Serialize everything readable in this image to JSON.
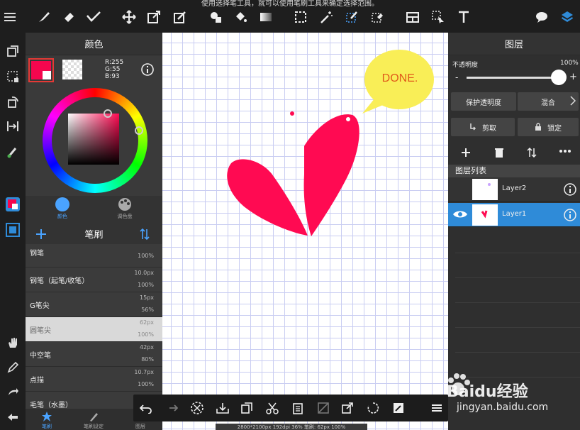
{
  "hint": "使用选择笔工具，就可以使用笔刷工具来确定选择范围。",
  "color_panel": {
    "title": "颜色",
    "primary_color": "#f5064e",
    "rgb": {
      "r": "R:255",
      "g": "G:55",
      "b": "B:93"
    },
    "tab_color": "颜色",
    "tab_palette": "调色盘"
  },
  "brush_panel": {
    "title": "笔刷",
    "brushes": [
      {
        "name": "钢笔",
        "size": "",
        "opacity": "100%"
      },
      {
        "name": "钢笔（起笔/收笔）",
        "size": "10.0px",
        "opacity": "100%"
      },
      {
        "name": "G笔尖",
        "size": "15px",
        "opacity": "56%"
      },
      {
        "name": "圆笔尖",
        "size": "62px",
        "opacity": "100%"
      },
      {
        "name": "中空笔",
        "size": "42px",
        "opacity": "80%"
      },
      {
        "name": "点描",
        "size": "10.7px",
        "opacity": "100%"
      },
      {
        "name": "毛笔（水墨）",
        "size": "",
        "opacity": ""
      }
    ],
    "bottom_tabs": [
      "笔刷",
      "笔刷设定",
      "图层"
    ]
  },
  "canvas": {
    "bubble_text": "DONE.",
    "heart_color": "#ff0a52",
    "bubble_color": "#f9ee57"
  },
  "layer_panel": {
    "title": "图层",
    "opacity_label": "不透明度",
    "opacity_value": "100%",
    "opacity": 1.0,
    "minus": "-",
    "plus": "+",
    "protect_alpha": "保护透明度",
    "blend": "混合",
    "clip": "剪取",
    "lock": "锁定",
    "list_title": "图层列表",
    "layers": [
      {
        "name": "Layer2",
        "selected": false
      },
      {
        "name": "Layer1",
        "selected": true
      }
    ]
  },
  "status": "2800*2100px 192dpi 36% 笔刷: 62px 100%",
  "watermark": {
    "brand": "Baidu经验",
    "url": "jingyan.baidu.com"
  }
}
